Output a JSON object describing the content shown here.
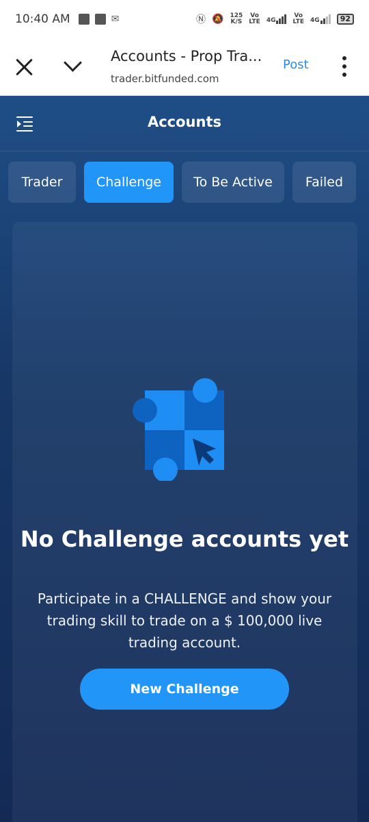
{
  "status_bar": {
    "time": "10:40 AM",
    "speed_value": "125",
    "speed_unit": "K/S",
    "net1_top": "Vo",
    "net1_bottom": "LTE",
    "net1_gen": "4G",
    "net2_top": "Vo",
    "net2_bottom": "LTE",
    "net2_gen": "4G",
    "battery": "92"
  },
  "browser": {
    "title": "Accounts - Prop Tra...",
    "url": "trader.bitfunded.com",
    "post_label": "Post"
  },
  "app": {
    "title": "Accounts",
    "tabs": [
      {
        "label": "Trader",
        "active": false
      },
      {
        "label": "Challenge",
        "active": true
      },
      {
        "label": "To Be Active",
        "active": false
      },
      {
        "label": "Failed",
        "active": false
      }
    ],
    "empty_state": {
      "title": "No Challenge accounts yet",
      "description": "Participate in a CHALLENGE and show your trading skill to trade on a $ 100,000 live trading account.",
      "button_label": "New Challenge"
    }
  },
  "colors": {
    "accent": "#2196f8",
    "bg_top": "#1f4e86",
    "bg_bottom": "#142a55",
    "link": "#2b8be6"
  },
  "icons": [
    "close-icon",
    "chevron-down-icon",
    "more-vert-icon",
    "menu-icon",
    "puzzle-cursor-icon",
    "nfc-icon",
    "mute-icon",
    "mail-icon"
  ]
}
